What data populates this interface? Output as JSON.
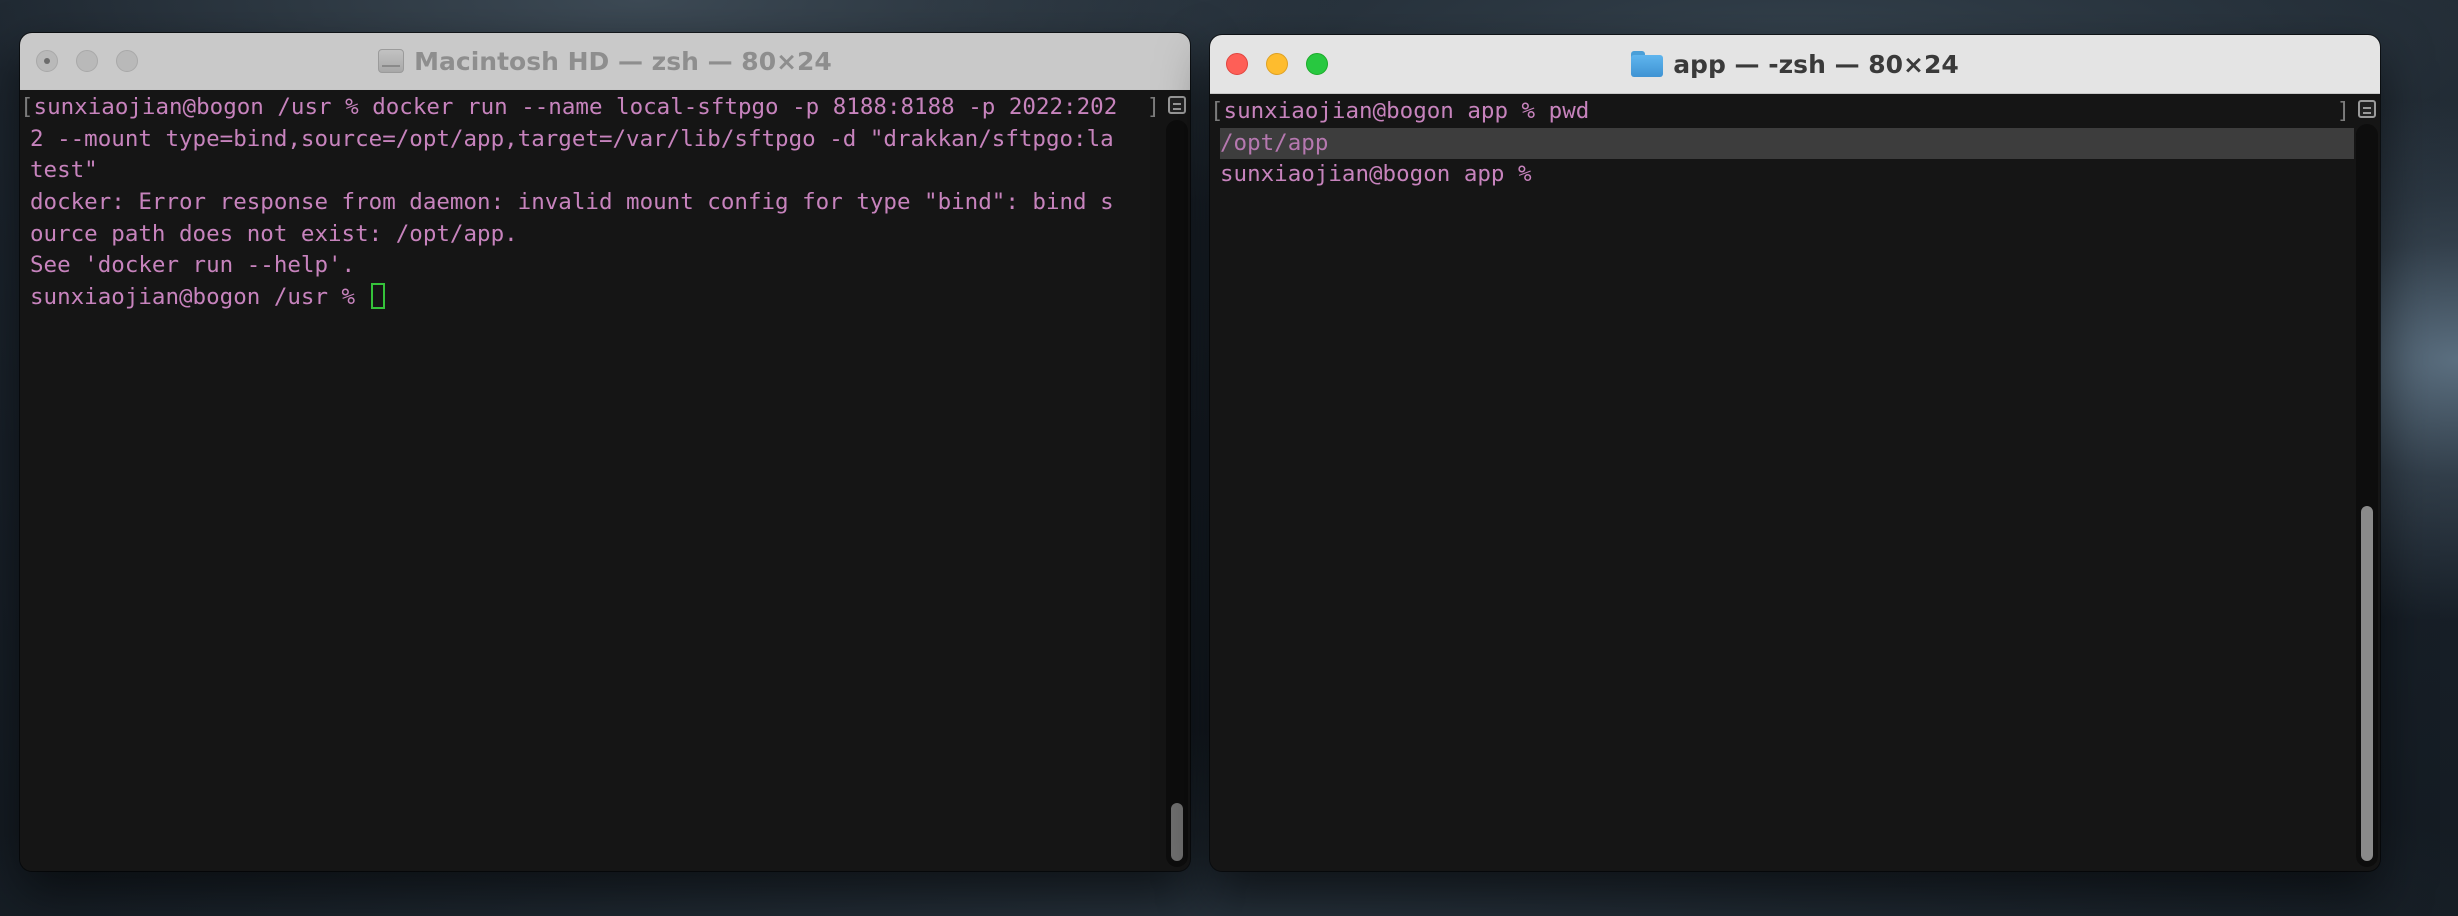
{
  "left_window": {
    "title": "Macintosh HD — zsh — 80×24",
    "icon": "hard-disk-icon",
    "lines": [
      "sunxiaojian@bogon /usr % docker run --name local-sftpgo -p 8188:8188 -p 2022:202",
      "2 --mount type=bind,source=/opt/app,target=/var/lib/sftpgo -d \"drakkan/sftpgo:la",
      "test\"",
      "docker: Error response from daemon: invalid mount config for type \"bind\": bind s",
      "ource path does not exist: /opt/app.",
      "See 'docker run --help'.",
      "sunxiaojian@bogon /usr % "
    ]
  },
  "right_window": {
    "title": "app — -zsh — 80×24",
    "icon": "folder-icon",
    "lines": [
      "sunxiaojian@bogon app % pwd",
      "/opt/app",
      "sunxiaojian@bogon app % "
    ]
  },
  "colors": {
    "terminal_text": "#c783bd",
    "cursor": "#35c23a",
    "traffic_close": "#fe5f57",
    "traffic_minimize": "#febc2e",
    "traffic_maximize": "#28c840"
  }
}
